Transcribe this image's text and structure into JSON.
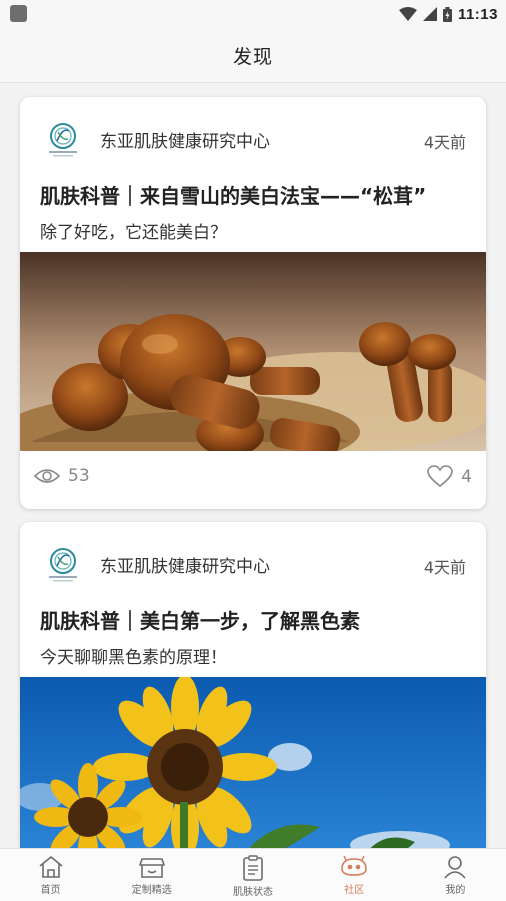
{
  "status_bar": {
    "time": "11:13"
  },
  "header": {
    "title": "发现"
  },
  "posts": [
    {
      "org": "东亚肌肤健康研究中心",
      "time": "4天前",
      "title": "肌肤科普｜来自雪山的美白法宝——“松茸”",
      "subtitle": "除了好吃，它还能美白？",
      "views": "53",
      "likes": "4"
    },
    {
      "org": "东亚肌肤健康研究中心",
      "time": "4天前",
      "title": "肌肤科普｜美白第一步，了解黑色素",
      "subtitle": "今天聊聊黑色素的原理！"
    }
  ],
  "nav": [
    {
      "label": "首页",
      "icon": "home-icon"
    },
    {
      "label": "定制精选",
      "icon": "shop-icon"
    },
    {
      "label": "肌肤状态",
      "icon": "clipboard-icon"
    },
    {
      "label": "社区",
      "icon": "community-icon",
      "active": true,
      "color": "#d47d5a"
    },
    {
      "label": "我的",
      "icon": "user-icon"
    }
  ]
}
